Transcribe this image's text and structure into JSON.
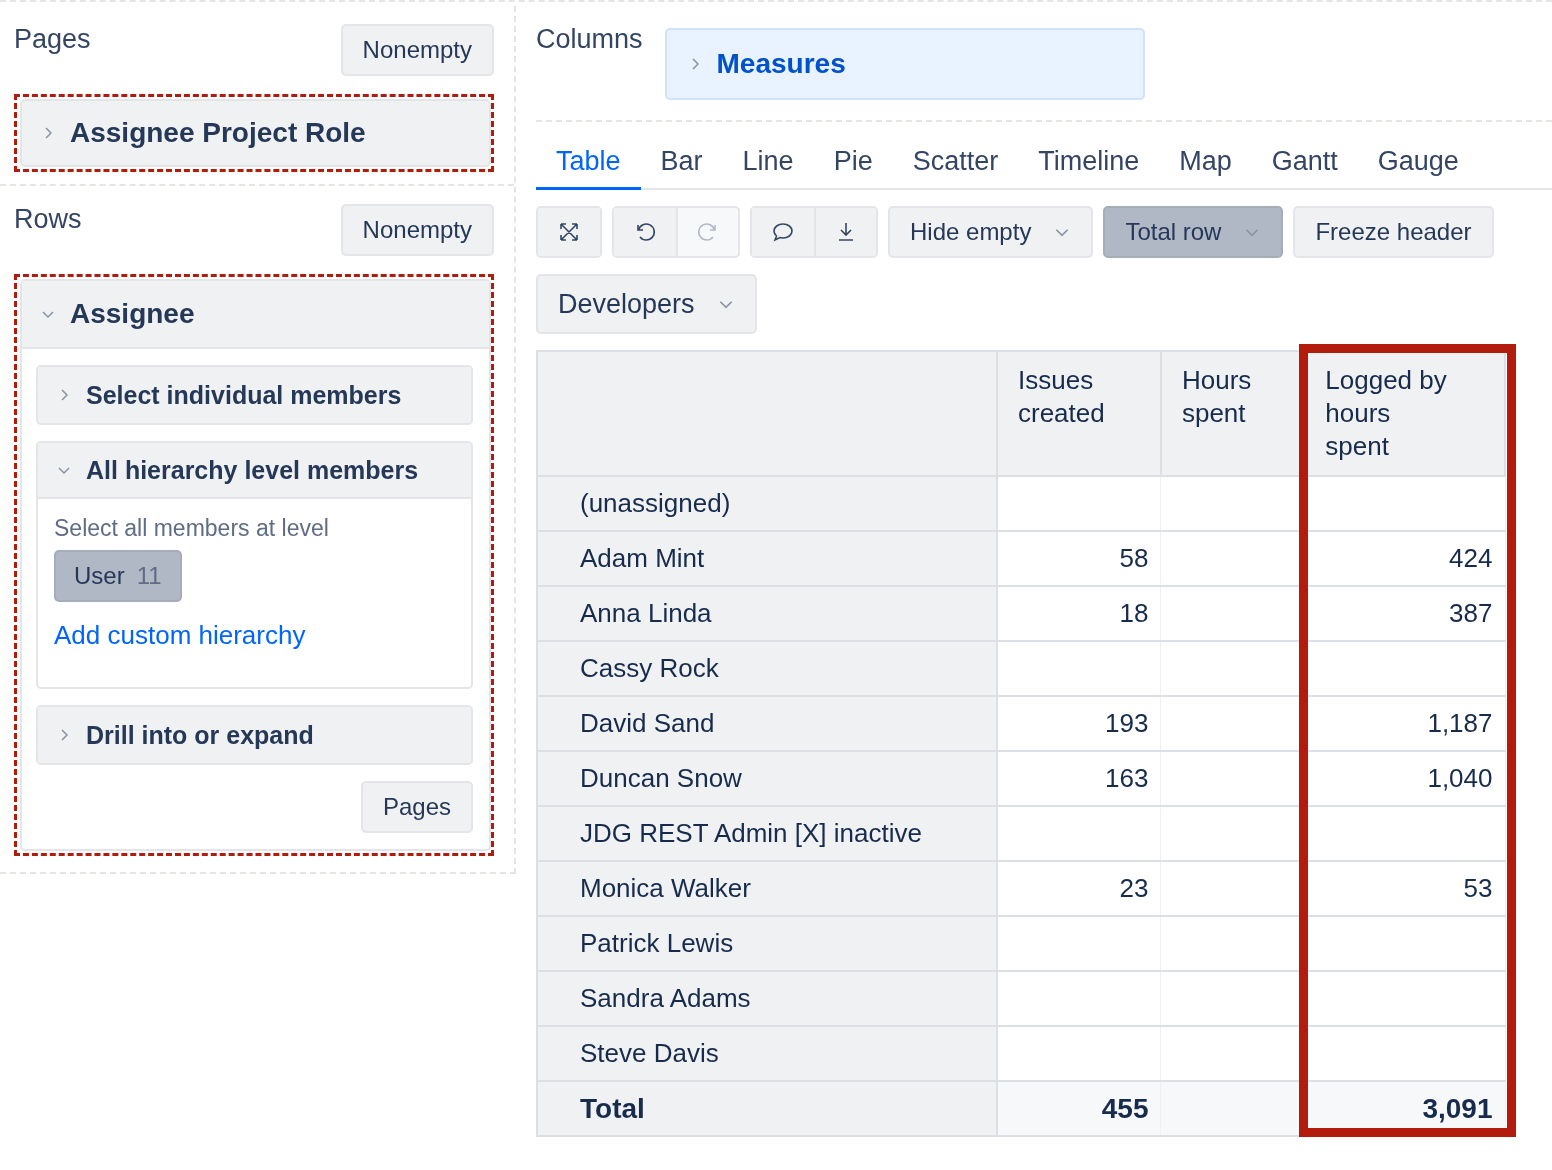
{
  "pages": {
    "title": "Pages",
    "button": "Nonempty",
    "highlighted": true,
    "items": [
      {
        "label": "Assignee Project Role",
        "expanded": false
      }
    ]
  },
  "rows": {
    "title": "Rows",
    "button": "Nonempty",
    "highlighted": true,
    "dimension": {
      "label": "Assignee",
      "expanded": true,
      "options": [
        {
          "label": "Select individual members",
          "expanded": false
        },
        {
          "label": "All hierarchy level members",
          "expanded": true,
          "hint": "Select all members at level",
          "level_chip": {
            "label": "User",
            "count": "11"
          },
          "link": "Add custom hierarchy"
        },
        {
          "label": "Drill into or expand",
          "expanded": false
        }
      ],
      "footer_button": "Pages"
    }
  },
  "columns": {
    "title": "Columns",
    "items": [
      {
        "label": "Measures",
        "expanded": false
      }
    ]
  },
  "tabs": [
    {
      "label": "Table",
      "selected": true
    },
    {
      "label": "Bar",
      "selected": false
    },
    {
      "label": "Line",
      "selected": false
    },
    {
      "label": "Pie",
      "selected": false
    },
    {
      "label": "Scatter",
      "selected": false
    },
    {
      "label": "Timeline",
      "selected": false
    },
    {
      "label": "Map",
      "selected": false
    },
    {
      "label": "Gantt",
      "selected": false
    },
    {
      "label": "Gauge",
      "selected": false
    }
  ],
  "toolbar": {
    "icon_groups": [
      [
        {
          "kind": "expand",
          "disabled": false
        }
      ],
      [
        {
          "kind": "undo",
          "disabled": false
        },
        {
          "kind": "redo",
          "disabled": true
        }
      ],
      [
        {
          "kind": "comment",
          "disabled": false
        },
        {
          "kind": "download",
          "disabled": false
        }
      ]
    ],
    "buttons": [
      {
        "label": "Hide empty",
        "selected": false,
        "dropdown": true
      },
      {
        "label": "Total row",
        "selected": true,
        "dropdown": true
      },
      {
        "label": "Freeze header",
        "selected": false,
        "dropdown": false
      }
    ],
    "filter": {
      "label": "Developers"
    }
  },
  "table": {
    "columns": [
      {
        "label": "Issues created",
        "highlighted": false
      },
      {
        "label": "Hours spent",
        "highlighted": false
      },
      {
        "label": "Logged by hours spent",
        "highlighted": true
      }
    ],
    "rows": [
      {
        "name": "(unassigned)",
        "total": false
      },
      {
        "name": "Adam Mint",
        "issues_created": "58",
        "logged_by_hours_spent": "424",
        "total": false
      },
      {
        "name": "Anna Linda",
        "issues_created": "18",
        "logged_by_hours_spent": "387",
        "total": false
      },
      {
        "name": "Cassy Rock",
        "total": false
      },
      {
        "name": "David Sand",
        "issues_created": "193",
        "logged_by_hours_spent": "1,187",
        "total": false
      },
      {
        "name": "Duncan Snow",
        "issues_created": "163",
        "logged_by_hours_spent": "1,040",
        "total": false
      },
      {
        "name": "JDG REST Admin [X] inactive",
        "total": false
      },
      {
        "name": "Monica Walker",
        "issues_created": "23",
        "logged_by_hours_spent": "53",
        "total": false
      },
      {
        "name": "Patrick Lewis",
        "total": false
      },
      {
        "name": "Sandra Adams",
        "total": false
      },
      {
        "name": "Steve Davis",
        "total": false
      },
      {
        "name": "Total",
        "issues_created": "455",
        "logged_by_hours_spent": "3,091",
        "total": true
      }
    ]
  }
}
